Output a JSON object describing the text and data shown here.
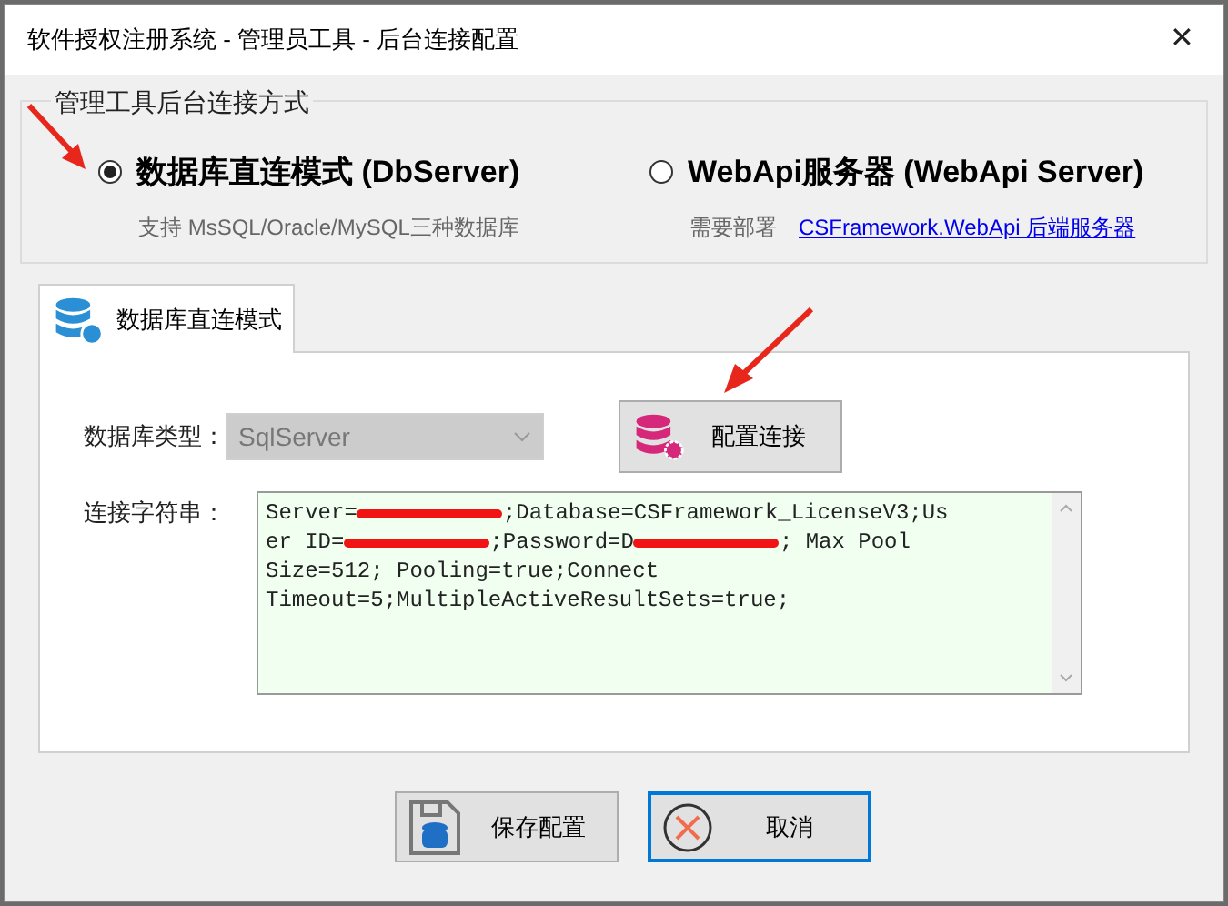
{
  "window": {
    "title": "软件授权注册系统 - 管理员工具 - 后台连接配置",
    "close": "✕"
  },
  "mode_group": {
    "title": "管理工具后台连接方式",
    "options": [
      {
        "label": "数据库直连模式 (DbServer)",
        "selected": true,
        "note": "支持 MsSQL/Oracle/MySQL三种数据库"
      },
      {
        "label": "WebApi服务器 (WebApi Server)",
        "selected": false,
        "note": "需要部署",
        "link": "CSFramework.WebApi 后端服务器"
      }
    ]
  },
  "tabs": [
    {
      "label": "数据库直连模式",
      "selected": true
    }
  ],
  "db_type": {
    "label": "数据库类型：",
    "value": "SqlServer",
    "disabled": true
  },
  "config_button": "配置连接",
  "connection_string": {
    "label": "连接字符串：",
    "lines": [
      [
        {
          "kind": "text",
          "text": "Server="
        },
        {
          "kind": "redaction"
        },
        {
          "kind": "text",
          "text": ";Database=CSFramework_LicenseV3;Us"
        }
      ],
      [
        {
          "kind": "text",
          "text": "er ID="
        },
        {
          "kind": "redaction"
        },
        {
          "kind": "text",
          "text": ";Password=D"
        },
        {
          "kind": "redaction"
        },
        {
          "kind": "text",
          "text": "; Max Pool"
        }
      ],
      [
        {
          "kind": "text",
          "text": "Size=512; Pooling=true;Connect"
        }
      ],
      [
        {
          "kind": "text",
          "text": "Timeout=5;MultipleActiveResultSets=true;"
        }
      ]
    ]
  },
  "buttons": [
    {
      "label": "保存配置",
      "kind": "save",
      "focused": false
    },
    {
      "label": "取消",
      "kind": "cancel",
      "focused": true
    }
  ]
}
